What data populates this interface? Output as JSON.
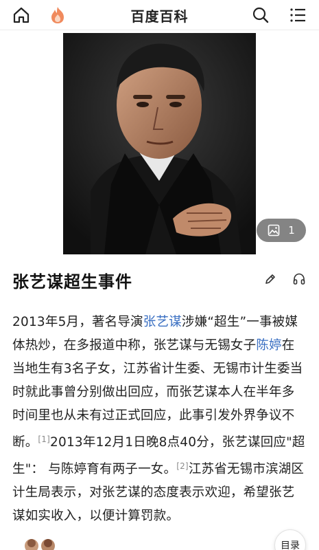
{
  "header": {
    "title": "百度百科",
    "icons": [
      "home-icon",
      "baidu-flame-logo",
      "search-icon",
      "menu-icon"
    ]
  },
  "hero": {
    "gallery_count": "1"
  },
  "article": {
    "title": "张艺谋超生事件",
    "p1": "2013年5月，著名导演",
    "link1": "张艺谋",
    "p2": "涉嫌“超生”一事被媒体热炒，在多报道中称，张艺谋与无锡女子",
    "link2": "陈婷",
    "p3": "在当地生有3名子女，江苏省计生委、无锡市计生委当时就此事曾分别做出回应，而张艺谋本人在半年多时间里也从未有过正式回应，此事引发外界争议不断。",
    "ref1": "[1]",
    "p4": "2013年12月1日晚8点40分，张艺谋回应\"超生\"： 与陈婷育有两子一女。",
    "ref2": "[2]",
    "p5": "江苏省无锡市滨湖区计生局表示，对张艺谋的态度表示欢迎，希望张艺谋如实收入，以便计算罚款。"
  },
  "toc": {
    "label": "目录"
  },
  "colors": {
    "link": "#3a6fc2",
    "logo": "#f08a5d"
  }
}
